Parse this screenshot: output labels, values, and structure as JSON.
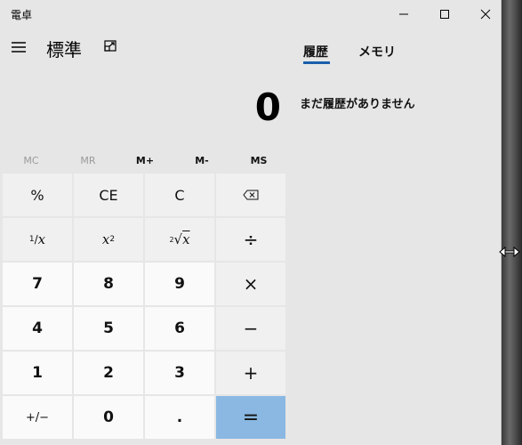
{
  "window": {
    "title": "電卓"
  },
  "header": {
    "mode": "標準"
  },
  "display": {
    "value": "0"
  },
  "memory_buttons": [
    "MC",
    "MR",
    "M+",
    "M-",
    "MS"
  ],
  "keys": {
    "percent": "%",
    "ce": "CE",
    "c": "C",
    "reciprocal_num": "1",
    "reciprocal_den": "x",
    "square_base": "x",
    "square_exp": "2",
    "sqrt_index": "2",
    "sqrt_radicand": "x",
    "divide": "÷",
    "n7": "7",
    "n8": "8",
    "n9": "9",
    "multiply": "×",
    "n4": "4",
    "n5": "5",
    "n6": "6",
    "minus": "−",
    "n1": "1",
    "n2": "2",
    "n3": "3",
    "plus": "+",
    "negate": "+/−",
    "n0": "0",
    "decimal": ".",
    "equals": "="
  },
  "side_panel": {
    "tabs": [
      "履歴",
      "メモリ"
    ],
    "active_tab": "履歴",
    "empty_message": "まだ履歴がありません"
  },
  "colors": {
    "accent": "#1b5fad",
    "equals_key": "#8ab8e2",
    "background": "#e6e6e6"
  }
}
